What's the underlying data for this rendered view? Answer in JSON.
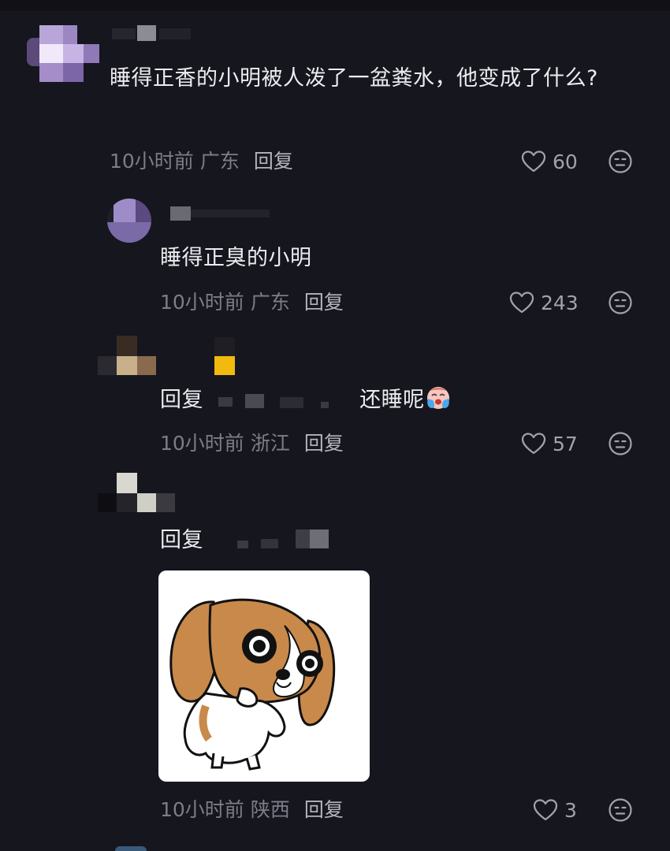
{
  "comments": [
    {
      "text": "睡得正香的小明被人泼了一盆粪水，他变成了什么?",
      "time": "10小时前",
      "region": "广东",
      "reply_label": "回复",
      "likes": "60"
    },
    {
      "text": "睡得正臭的小明",
      "time": "10小时前",
      "region": "广东",
      "reply_label": "回复",
      "likes": "243"
    },
    {
      "reply_prefix": "回复",
      "text": "还睡呢",
      "emoji": "crying-face-emoji",
      "time": "10小时前",
      "region": "浙江",
      "reply_label": "回复",
      "likes": "57"
    },
    {
      "reply_prefix": "回复",
      "sticker": "dog-sticker",
      "time": "10小时前",
      "region": "陕西",
      "reply_label": "回复",
      "likes": "3"
    }
  ],
  "icons": {
    "like": "heart-outline-icon",
    "more": "face-more-icon"
  },
  "colors": {
    "background": "#16161e",
    "meta": "#7d7d88",
    "reply": "#b4b4be"
  }
}
